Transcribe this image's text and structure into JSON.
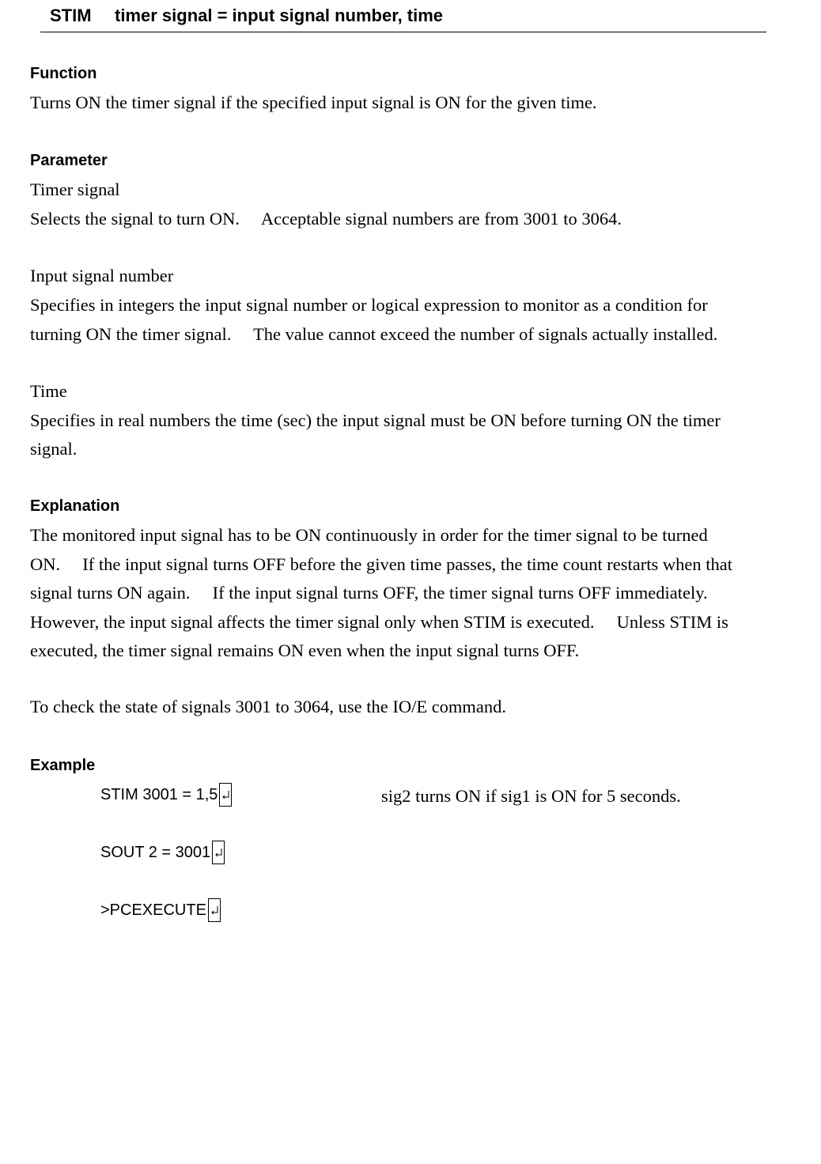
{
  "title": {
    "command": "STIM",
    "syntax": "timer signal = input signal number, time"
  },
  "function": {
    "heading": "Function",
    "text": "Turns ON the timer signal if the specified input signal is ON for the given time."
  },
  "parameter": {
    "heading": "Parameter",
    "timer_signal": {
      "name": "Timer signal",
      "desc": "Selects the signal to turn ON.  Acceptable signal numbers are from 3001 to 3064."
    },
    "input_signal_number": {
      "name": "Input signal number",
      "desc_lines": [
        "Specifies in integers the input signal number or logical expression to monitor as a condition for",
        "turning ON the timer signal.  The value cannot exceed the number of signals actually installed."
      ]
    },
    "time": {
      "name": "Time",
      "desc_lines": [
        "Specifies in real numbers the time (sec) the input signal must be ON before turning ON the timer",
        "signal."
      ]
    }
  },
  "explanation": {
    "heading": "Explanation",
    "lines": [
      "The monitored input signal has to be ON continuously in order for the timer signal to be turned",
      "ON.  If the input signal turns OFF before the given time passes, the time count restarts when that",
      "signal turns ON again.  If the input signal turns OFF, the timer signal turns OFF immediately.",
      "However, the input signal affects the timer signal only when STIM is executed.  Unless STIM is",
      "executed, the timer signal remains ON even when the input signal turns OFF."
    ],
    "note": "To check the state of signals 3001 to 3064, use the IO/E command."
  },
  "example": {
    "heading": "Example",
    "lines": [
      {
        "code": "STIM 3001 = 1,5",
        "comment": "sig2 turns ON if sig1 is ON for 5 seconds."
      },
      {
        "code": "SOUT 2 = 3001",
        "comment": ""
      },
      {
        "code": ">PCEXECUTE",
        "comment": ""
      }
    ],
    "enter_icon": "enter-key-icon"
  }
}
